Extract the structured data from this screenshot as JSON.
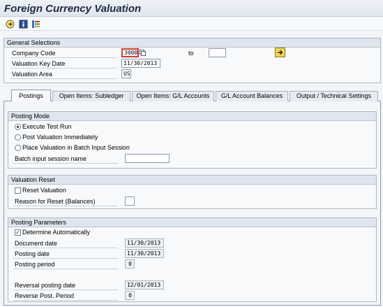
{
  "window": {
    "title": "Foreign Currency Valuation"
  },
  "toolbar": {
    "icons": [
      "execute-icon",
      "info-icon",
      "variants-icon"
    ]
  },
  "general_selections": {
    "header": "General Selections",
    "company_code_label": "Company Code",
    "company_code_value": "3000",
    "to_label": "to",
    "company_code_to_value": "",
    "valuation_key_date_label": "Valuation Key Date",
    "valuation_key_date_value": "11/30/2013",
    "valuation_area_label": "Valuation Area",
    "valuation_area_value": "US"
  },
  "tabs": [
    {
      "label": "Postings",
      "active": true
    },
    {
      "label": "Open Items: Subledger",
      "active": false
    },
    {
      "label": "Open Items: G/L Accounts",
      "active": false
    },
    {
      "label": "G/L Account Balances",
      "active": false
    },
    {
      "label": "Output / Technical Settings",
      "active": false
    }
  ],
  "posting_mode": {
    "header": "Posting Mode",
    "options": [
      {
        "label": "Execute Test Run",
        "selected": true
      },
      {
        "label": "Post Valuation Immediately",
        "selected": false
      },
      {
        "label": "Place Valuation in Batch Input Session",
        "selected": false
      }
    ],
    "batch_session_label": "Batch input session name",
    "batch_session_value": ""
  },
  "valuation_reset": {
    "header": "Valuation Reset",
    "reset_label": "Reset Valuation",
    "reset_checked": false,
    "reason_label": "Reason for Reset (Balances)",
    "reason_value": ""
  },
  "posting_parameters": {
    "header": "Posting Parameters",
    "determine_label": "Determine Automatically",
    "determine_checked": true,
    "document_date_label": "Document date",
    "document_date_value": "11/30/2013",
    "posting_date_label": "Posting date",
    "posting_date_value": "11/30/2013",
    "posting_period_label": "Posting period",
    "posting_period_value": "0",
    "reversal_date_label": "Reversal posting date",
    "reversal_date_value": "12/01/2013",
    "reverse_period_label": "Reverse Post. Period",
    "reverse_period_value": "0"
  }
}
